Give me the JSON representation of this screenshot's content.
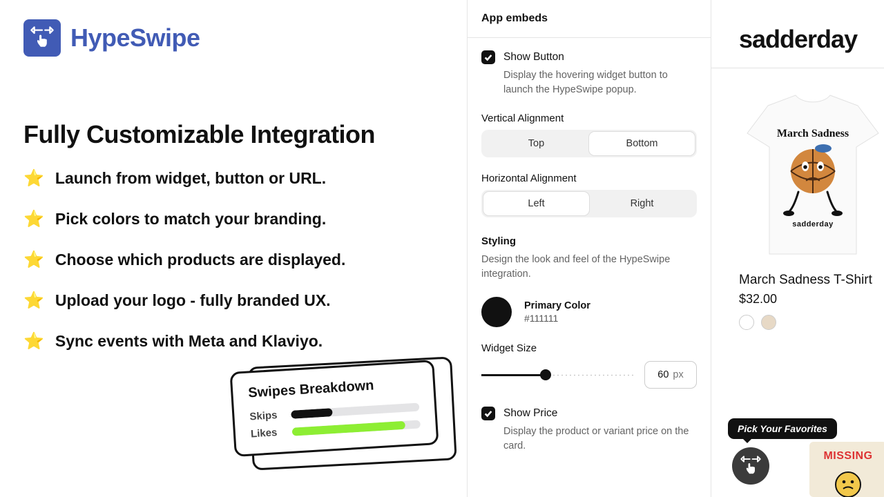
{
  "brand": {
    "name": "HypeSwipe"
  },
  "headline": "Fully Customizable Integration",
  "bullets": [
    "Launch from widget, button or URL.",
    "Pick colors to match your branding.",
    "Choose which products are displayed.",
    "Upload your logo - fully branded UX.",
    "Sync events with Meta and Klaviyo."
  ],
  "breakdown": {
    "title": "Swipes Breakdown",
    "rows": [
      {
        "label": "Skips",
        "pct": 32
      },
      {
        "label": "Likes",
        "pct": 88
      }
    ]
  },
  "settings": {
    "header": "App embeds",
    "show_button": {
      "label": "Show Button",
      "desc": "Display the hovering widget button to launch the HypeSwipe popup."
    },
    "vertical": {
      "label": "Vertical Alignment",
      "options": [
        "Top",
        "Bottom"
      ],
      "selected": "Bottom"
    },
    "horizontal": {
      "label": "Horizontal Alignment",
      "options": [
        "Left",
        "Right"
      ],
      "selected": "Left"
    },
    "styling": {
      "title": "Styling",
      "desc": "Design the look and feel of the HypeSwipe integration."
    },
    "primary_color": {
      "label": "Primary Color",
      "hex": "#111111"
    },
    "widget_size": {
      "label": "Widget Size",
      "value": "60",
      "unit": "px",
      "pct": 42
    },
    "show_price": {
      "label": "Show Price",
      "desc": "Display the product or variant price on the card."
    }
  },
  "preview": {
    "store_name": "sadderday",
    "product": {
      "title": "March Sadness T-Shirt",
      "price": "$32.00",
      "graphic_top": "March Sadness",
      "graphic_bottom": "sadderday",
      "swatches": [
        "#ffffff",
        "#e7d9c6"
      ]
    },
    "tooltip": "Pick Your Favorites",
    "thumb_label": "MISSING"
  }
}
